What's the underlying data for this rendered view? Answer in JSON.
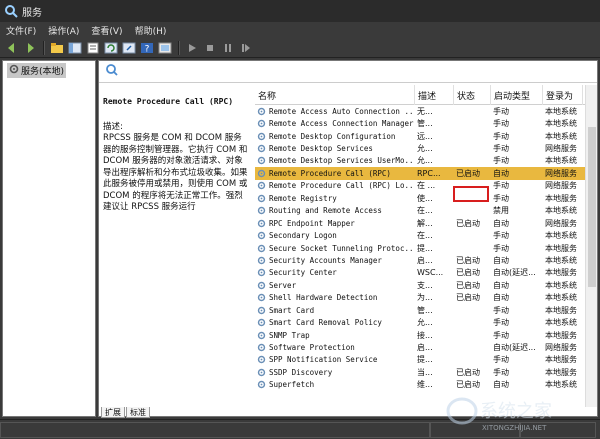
{
  "window": {
    "title": "服务"
  },
  "menu": [
    "文件(F)",
    "操作(A)",
    "查看(V)",
    "帮助(H)"
  ],
  "toolbar": {
    "buttons": [
      "back-icon",
      "forward-icon",
      "up-icon",
      "show-hide-tree-icon",
      "properties-icon",
      "refresh-icon",
      "export-icon",
      "help-icon",
      "console-icon",
      "play-icon",
      "stop-icon",
      "pause-icon",
      "restart-icon"
    ]
  },
  "tree": {
    "root_label": "服务(本地)"
  },
  "description": {
    "service_title": "Remote Procedure Call (RPC)",
    "label": "描述:",
    "text": "RPCSS 服务是 COM 和 DCOM 服务器的服务控制管理器。它执行 COM 和 DCOM 服务器的对象激活请求、对象导出程序解析和分布式垃圾收集。如果此服务被停用或禁用，则使用 COM 或 DCOM 的程序将无法正常工作。强烈建议让 RPCSS 服务运行"
  },
  "table": {
    "columns": [
      "名称",
      "描述",
      "状态",
      "启动类型",
      "登录为"
    ],
    "rows": [
      [
        "Remote Access Auto Connection ...",
        "无...",
        "",
        "手动",
        "本地系统"
      ],
      [
        "Remote Access Connection Manager",
        "管...",
        "",
        "手动",
        "本地系统"
      ],
      [
        "Remote Desktop Configuration",
        "远...",
        "",
        "手动",
        "本地系统"
      ],
      [
        "Remote Desktop Services",
        "允...",
        "",
        "手动",
        "网络服务"
      ],
      [
        "Remote Desktop Services UserMo...",
        "允...",
        "",
        "手动",
        "本地系统"
      ],
      [
        "Remote Procedure Call (RPC)",
        "RPC...",
        "已启动",
        "自动",
        "网络服务"
      ],
      [
        "Remote Procedure Call (RPC) Lo...",
        "在 ...",
        "",
        "手动",
        "网络服务"
      ],
      [
        "Remote Registry",
        "使...",
        "",
        "手动",
        "本地服务"
      ],
      [
        "Routing and Remote Access",
        "在...",
        "",
        "禁用",
        "本地系统"
      ],
      [
        "RPC Endpoint Mapper",
        "解...",
        "已启动",
        "自动",
        "网络服务"
      ],
      [
        "Secondary Logon",
        "在...",
        "",
        "手动",
        "本地系统"
      ],
      [
        "Secure Socket Tunneling Protoc...",
        "提...",
        "",
        "手动",
        "本地服务"
      ],
      [
        "Security Accounts Manager",
        "启...",
        "已启动",
        "自动",
        "本地系统"
      ],
      [
        "Security Center",
        "WSC...",
        "已启动",
        "自动(延迟...",
        "本地服务"
      ],
      [
        "Server",
        "支...",
        "已启动",
        "自动",
        "本地系统"
      ],
      [
        "Shell Hardware Detection",
        "为...",
        "已启动",
        "自动",
        "本地系统"
      ],
      [
        "Smart Card",
        "管...",
        "",
        "手动",
        "本地服务"
      ],
      [
        "Smart Card Removal Policy",
        "允...",
        "",
        "手动",
        "本地系统"
      ],
      [
        "SNMP Trap",
        "接...",
        "",
        "手动",
        "本地服务"
      ],
      [
        "Software Protection",
        "启...",
        "",
        "自动(延迟...",
        "网络服务"
      ],
      [
        "SPP Notification Service",
        "提...",
        "",
        "手动",
        "本地服务"
      ],
      [
        "SSDP Discovery",
        "当...",
        "已启动",
        "手动",
        "本地服务"
      ],
      [
        "Superfetch",
        "维...",
        "已启动",
        "自动",
        "本地系统"
      ]
    ],
    "selected_row": 5
  },
  "tabs": [
    "扩展",
    "标准"
  ],
  "watermark": {
    "text": "系统之家",
    "subtext": "XITONGZHIJIA.NET"
  },
  "colors": {
    "selection": "#e9b83f",
    "highlight_box": "#d81e1e",
    "chrome_dark": "#3a3a3a"
  }
}
